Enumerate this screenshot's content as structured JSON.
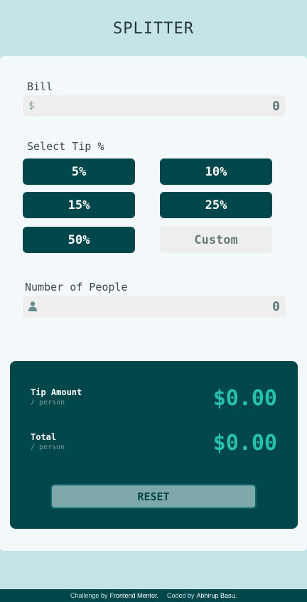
{
  "app": {
    "title": "SPLITTER"
  },
  "bill": {
    "label": "Bill",
    "prefix": "$",
    "value": "0"
  },
  "tip": {
    "label": "Select Tip %",
    "options": [
      "5%",
      "10%",
      "15%",
      "25%",
      "50%"
    ],
    "custom_placeholder": "Custom"
  },
  "people": {
    "label": "Number of People",
    "value": "0",
    "icon": "person-icon"
  },
  "results": {
    "tip_amount": {
      "label": "Tip Amount",
      "sub": "/ person",
      "value": "$0.00"
    },
    "total": {
      "label": "Total",
      "sub": "/ person",
      "value": "$0.00"
    },
    "reset_label": "RESET"
  },
  "footer": {
    "challenge_prefix": "Challenge by",
    "challenge_link": "Frontend Mentor.",
    "coded_prefix": "Coded by",
    "coded_link": "Abhirup Basu."
  },
  "colors": {
    "background": "#c5e4e7",
    "accent": "#00474b",
    "highlight": "#26c2ad"
  }
}
